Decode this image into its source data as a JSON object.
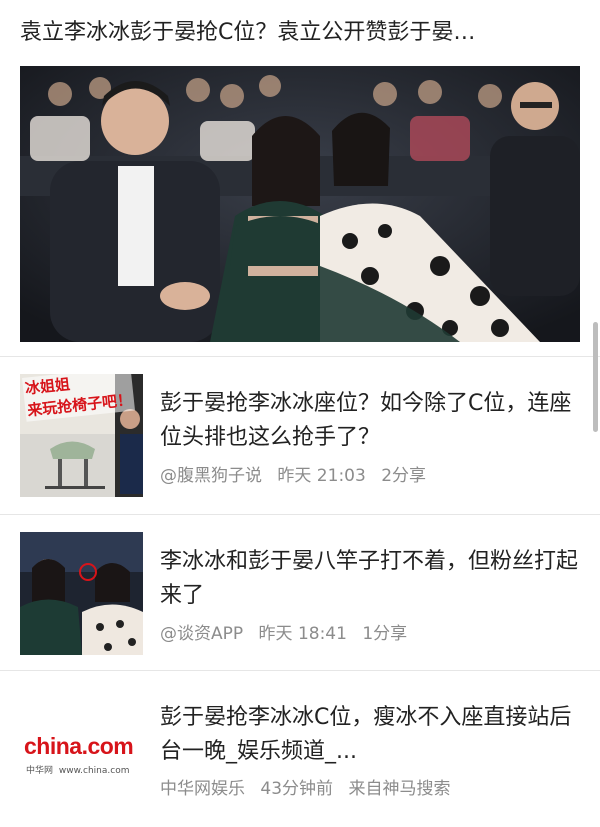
{
  "feed": {
    "items": [
      {
        "title": "袁立李冰冰彭于晏抢C位？袁立公开赞彭于晏…"
      },
      {
        "title": "彭于晏抢李冰冰座位？如今除了C位，连座位头排也这么抢手了？",
        "thumb_text": [
          "冰姐姐",
          "来玩抢椅子吧！"
        ],
        "source": "@腹黑狗子说",
        "time": "昨天 21:03",
        "shares": "2分享"
      },
      {
        "title": "李冰冰和彭于晏八竿子打不着，但粉丝打起来了",
        "source": "@谈资APP",
        "time": "昨天 18:41",
        "shares": "1分享"
      },
      {
        "title": "彭于晏抢李冰冰C位，瘦冰不入座直接站后台一晚_娱乐频道_...",
        "logo_main": "china.com",
        "logo_sub_cn": "中华网",
        "logo_sub_url": "www.china.com",
        "source": "中华网娱乐",
        "time": "43分钟前",
        "shares": "来自神马搜索"
      }
    ]
  },
  "colors": {
    "logo_red": "#d7141a",
    "meta_gray": "#8c8c8c",
    "divider": "#e6e6e6"
  }
}
